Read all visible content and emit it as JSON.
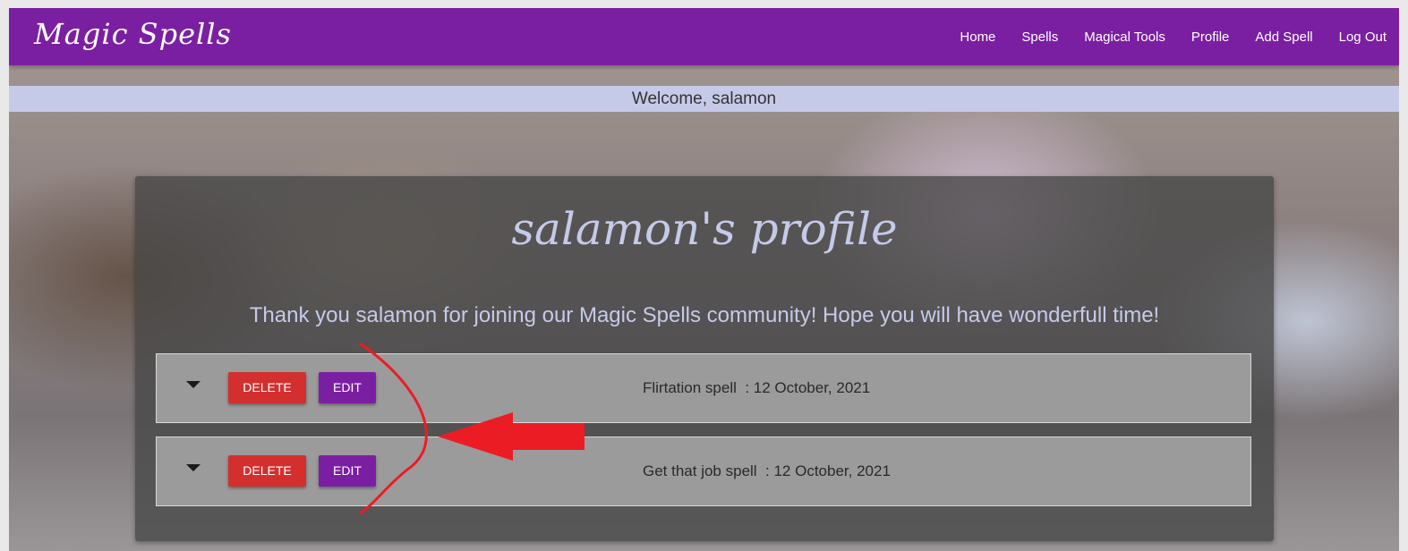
{
  "navbar": {
    "brand": "Magic Spells",
    "links": [
      "Home",
      "Spells",
      "Magical Tools",
      "Profile",
      "Add Spell",
      "Log Out"
    ]
  },
  "welcome": "Welcome, salamon",
  "profile": {
    "title": "salamon's profile",
    "intro": "Thank you salamon for joining our Magic Spells community! Hope you will have wonderfull time!",
    "spells": [
      {
        "name": "Flirtation spell",
        "date": "12 October, 2021",
        "display": "Flirtation spell  : 12 October, 2021",
        "delete_label": "DELETE",
        "edit_label": "EDIT"
      },
      {
        "name": "Get that job spell",
        "date": "12 October, 2021",
        "display": "Get that job spell  : 12 October, 2021",
        "delete_label": "DELETE",
        "edit_label": "EDIT"
      }
    ]
  },
  "icons": {
    "expand": "caret-down-icon"
  },
  "colors": {
    "navbar": "#7b1fa2",
    "welcome_bar": "#c5cae9",
    "delete_button": "#d32f2f",
    "edit_button": "#7b1fa2",
    "annotation": "#ec1c24"
  }
}
